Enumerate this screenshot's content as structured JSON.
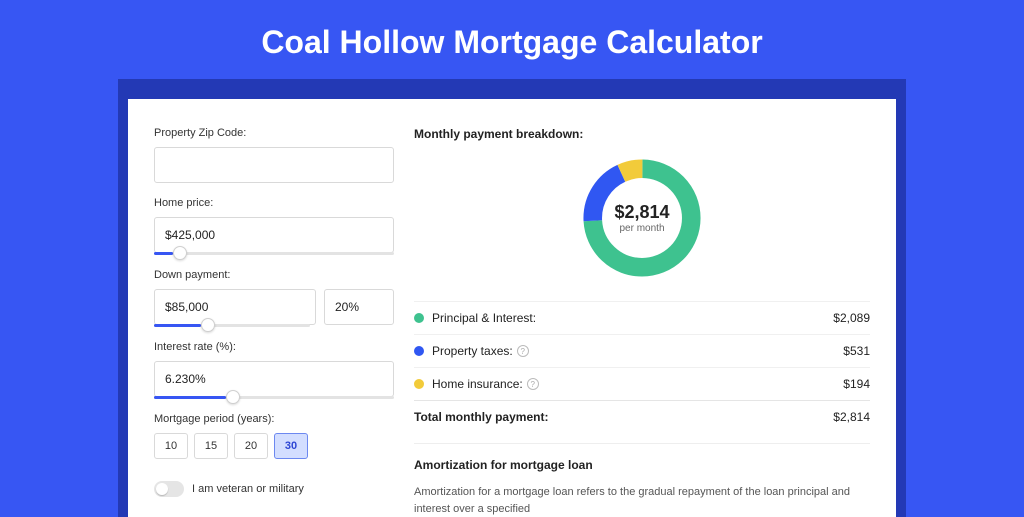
{
  "title": "Coal Hollow Mortgage Calculator",
  "form": {
    "zip": {
      "label": "Property Zip Code:",
      "value": ""
    },
    "price": {
      "label": "Home price:",
      "value": "$425,000",
      "slider_percent": 8
    },
    "down": {
      "label": "Down payment:",
      "amount": "$85,000",
      "percent": "20%",
      "slider_percent": 20
    },
    "rate": {
      "label": "Interest rate (%):",
      "value": "6.230%",
      "slider_percent": 30
    },
    "period": {
      "label": "Mortgage period (years):",
      "options": [
        "10",
        "15",
        "20",
        "30"
      ],
      "selected": "30"
    },
    "veteran": {
      "label": "I am veteran or military",
      "on": false
    }
  },
  "breakdown": {
    "title": "Monthly payment breakdown:",
    "center_amount": "$2,814",
    "center_sub": "per month",
    "rows": [
      {
        "label": "Principal & Interest:",
        "value": "$2,089",
        "color": "#3ec28f",
        "info": false
      },
      {
        "label": "Property taxes:",
        "value": "$531",
        "color": "#3057f2",
        "info": true
      },
      {
        "label": "Home insurance:",
        "value": "$194",
        "color": "#f2cb3a",
        "info": true
      }
    ],
    "total": {
      "label": "Total monthly payment:",
      "value": "$2,814"
    }
  },
  "chart_data": {
    "type": "pie",
    "title": "Monthly payment breakdown",
    "series": [
      {
        "name": "Principal & Interest",
        "value": 2089,
        "color": "#3ec28f"
      },
      {
        "name": "Property taxes",
        "value": 531,
        "color": "#3057f2"
      },
      {
        "name": "Home insurance",
        "value": 194,
        "color": "#f2cb3a"
      }
    ],
    "total": 2814
  },
  "amort": {
    "title": "Amortization for mortgage loan",
    "text": "Amortization for a mortgage loan refers to the gradual repayment of the loan principal and interest over a specified"
  }
}
